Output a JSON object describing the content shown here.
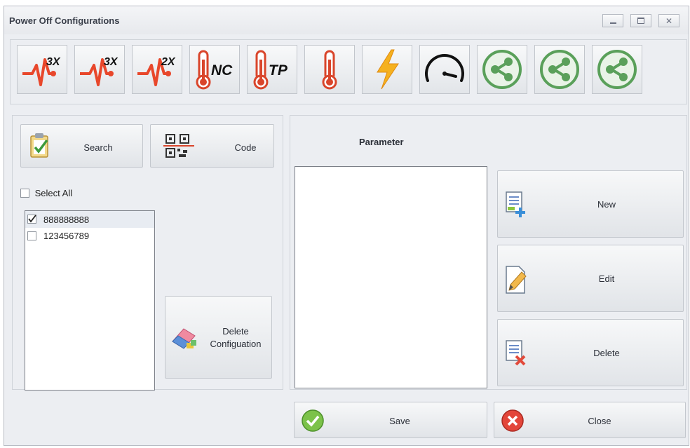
{
  "window": {
    "title": "Power Off Configurations",
    "controls": [
      "minimize-icon",
      "maximize-icon",
      "close-icon"
    ]
  },
  "toolbar": {
    "tools": [
      {
        "name": "vibration-3x",
        "badge": "3X",
        "icon": "pulse-icon"
      },
      {
        "name": "vibration-3x-b",
        "badge": "3X",
        "icon": "pulse-icon"
      },
      {
        "name": "vibration-2x",
        "badge": "2X",
        "icon": "pulse-icon"
      },
      {
        "name": "temperature-nc",
        "badge": "NC",
        "icon": "thermometer-icon"
      },
      {
        "name": "temperature-tp",
        "badge": "TP",
        "icon": "thermometer-icon"
      },
      {
        "name": "temperature",
        "badge": "",
        "icon": "thermometer-icon"
      },
      {
        "name": "power",
        "badge": "",
        "icon": "lightning-icon"
      },
      {
        "name": "speed",
        "badge": "",
        "icon": "speedometer-icon"
      },
      {
        "name": "share-1",
        "badge": "",
        "icon": "share-icon"
      },
      {
        "name": "share-2",
        "badge": "",
        "icon": "share-icon"
      },
      {
        "name": "share-3",
        "badge": "",
        "icon": "share-icon"
      }
    ]
  },
  "left_panel": {
    "search_label": "Search",
    "code_label": "Code",
    "select_all_label": "Select All",
    "select_all_checked": false,
    "items": [
      {
        "label": "888888888",
        "checked": true
      },
      {
        "label": "123456789",
        "checked": false
      }
    ],
    "delete_config_line1": "Delete",
    "delete_config_line2": "Configuation"
  },
  "right_panel": {
    "parameter_heading": "Parameter",
    "new_label": "New",
    "edit_label": "Edit",
    "delete_label": "Delete"
  },
  "footer": {
    "save_label": "Save",
    "close_label": "Close"
  },
  "colors": {
    "accent_red": "#e8472b",
    "accent_orange": "#f5a623",
    "accent_green": "#5aa05a"
  }
}
